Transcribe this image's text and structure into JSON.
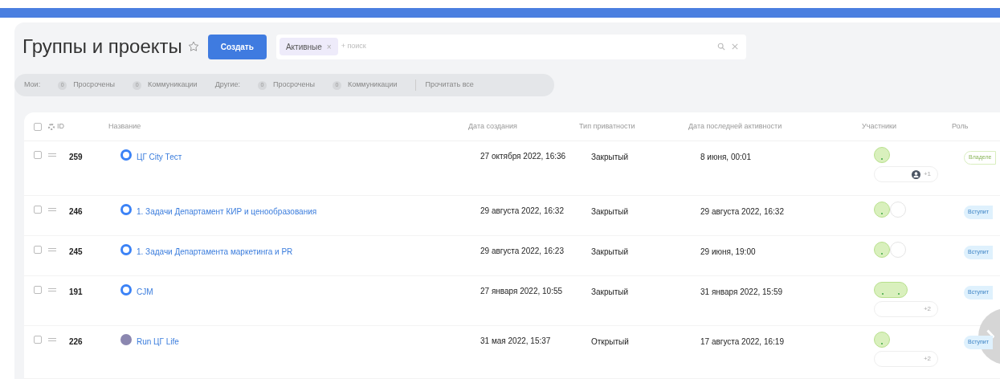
{
  "header": {
    "title": "Группы и проекты",
    "create_button": "Создать",
    "search": {
      "filter_chip": "Активные",
      "chip_close": "×",
      "placeholder": "+ поиск"
    }
  },
  "counters": [
    {
      "kind": "label",
      "text": "Мои:"
    },
    {
      "kind": "counter",
      "count": "0",
      "text": "Просрочены"
    },
    {
      "kind": "counter",
      "count": "0",
      "text": "Коммуникации"
    },
    {
      "kind": "label",
      "text": "Другие:"
    },
    {
      "kind": "counter",
      "count": "0",
      "text": "Просрочены"
    },
    {
      "kind": "counter",
      "count": "0",
      "text": "Коммуникации"
    },
    {
      "kind": "action",
      "text": "Прочитать все"
    }
  ],
  "table": {
    "columns": [
      "ID",
      "Название",
      "Дата создания",
      "Тип приватности",
      "Дата последней активности",
      "Участники",
      "Роль"
    ],
    "select_all_checked": false,
    "rows": [
      {
        "checked": false,
        "id": "259",
        "color": "#3b82f6",
        "name": "ЦГ City Тест",
        "created": "27 октября 2022, 16:36",
        "privacy": "Закрытый",
        "last_activity": "8 июня, 00:01",
        "avatars": [
          {
            "online": true
          }
        ],
        "empty_slot": false,
        "more": {
          "icon": true,
          "text": "+1"
        },
        "role": {
          "kind": "owner",
          "text": "Владеле"
        }
      },
      {
        "checked": false,
        "id": "246",
        "color": "#3b82f6",
        "name": "1. Задачи Департамент КИР и ценообразования",
        "created": "29 августа 2022, 16:32",
        "privacy": "Закрытый",
        "last_activity": "29 августа 2022, 16:32",
        "avatars": [
          {
            "online": true
          }
        ],
        "empty_slot": true,
        "role": {
          "kind": "join",
          "text": "Вступит"
        }
      },
      {
        "checked": false,
        "id": "245",
        "color": "#3b82f6",
        "name": "1. Задачи Департамента маркетинга и PR",
        "created": "29 августа 2022, 16:23",
        "privacy": "Закрытый",
        "last_activity": "29 июня, 19:00",
        "avatars": [
          {
            "online": true
          }
        ],
        "empty_slot": true,
        "role": {
          "kind": "join",
          "text": "Вступит"
        }
      },
      {
        "checked": false,
        "id": "191",
        "color": "#3b82f6",
        "name": "CJM",
        "created": "27 января 2022, 10:55",
        "privacy": "Закрытый",
        "last_activity": "31 января 2022, 15:59",
        "avatars": [
          {
            "online": true
          },
          {
            "online": true
          }
        ],
        "empty_slot": false,
        "more": {
          "icon": false,
          "text": "+2"
        },
        "role": {
          "kind": "join",
          "text": "Вступит"
        }
      },
      {
        "checked": false,
        "id": "226",
        "color": "#8b87b0",
        "name": "Run ЦГ Life",
        "created": "31 мая 2022, 15:37",
        "privacy": "Открытый",
        "last_activity": "17 августа 2022, 16:19",
        "avatars": [
          {
            "online": true
          }
        ],
        "empty_slot": false,
        "more": {
          "icon": false,
          "text": "+2"
        },
        "role": {
          "kind": "join",
          "text": "Вступит"
        }
      }
    ]
  }
}
